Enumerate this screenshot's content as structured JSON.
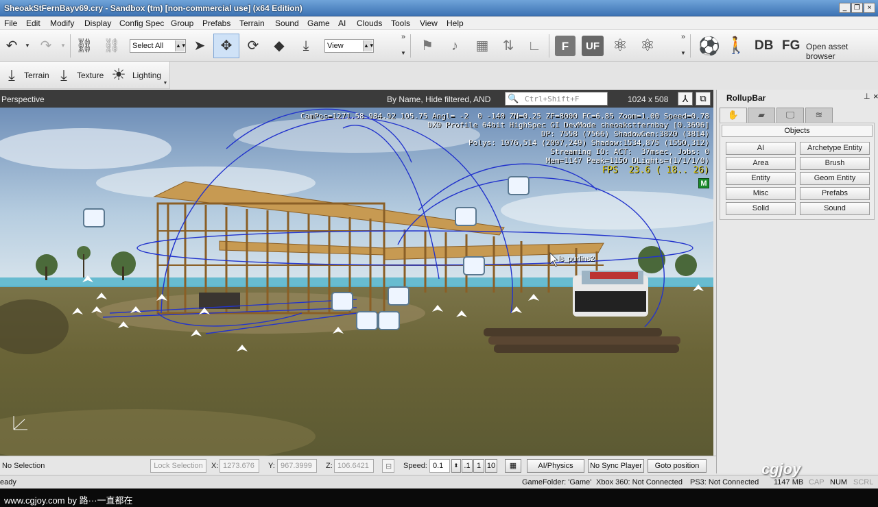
{
  "window": {
    "title": "SheoakStFernBayv69.cry - Sandbox (tm) [non-commercial use] (x64 Edition)",
    "minimize": "_",
    "restore": "❐",
    "close": "×"
  },
  "menu": [
    "File",
    "Edit",
    "Modify",
    "Display",
    "Config Spec",
    "Group",
    "Prefabs",
    "Terrain",
    "Sound",
    "Game",
    "AI",
    "Clouds",
    "Tools",
    "View",
    "Help"
  ],
  "toolbar": {
    "select_combo": "Select All",
    "view_combo": "View",
    "db_label": "DB",
    "fg_label": "FG",
    "f_label": "F",
    "uf_label": "UF",
    "asset_browser": "Open asset browser"
  },
  "toolbar2": {
    "terrain": "Terrain",
    "texture": "Texture",
    "lighting": "Lighting"
  },
  "viewport": {
    "name": "Perspective",
    "filter": "By Name, Hide filtered, AND",
    "search_placeholder": "Ctrl+Shift+F",
    "resolution": "1024 x 508",
    "hud_lines": [
      "CamPos=1271.58 984.92 105.75 Angl= -2  0 -140 ZN=0.25 ZF=8000 FC=6.85 Zoom=1.00 Speed=0.78",
      "DX9 Profile 64bit HighSpec GI DevMode sheoakstfernbay [0.3696]",
      "DP: 7558 (7566) ShadowGen:3820 (3814)",
      "Polys: 1976,514 (2097,249) Shadow:1534,875 (1550,312)",
      "Streaming IO: ACT:  37msec, Jobs: 0",
      "Mem=1147 Peak=1150 DLights=(1/1/1/0)"
    ],
    "fps": "FPS  23.6 ( 18.. 26)",
    "m_badge": "M",
    "object_label": "ls_purlins2"
  },
  "rollup": {
    "title": "RollupBar",
    "pin": "⊥",
    "close": "×",
    "section": "Objects",
    "buttons": [
      [
        "AI",
        "Archetype Entity"
      ],
      [
        "Area",
        "Brush"
      ],
      [
        "Entity",
        "Geom Entity"
      ],
      [
        "Misc",
        "Prefabs"
      ],
      [
        "Solid",
        "Sound"
      ]
    ]
  },
  "status": {
    "selection": "No Selection",
    "lock_selection": "Lock Selection",
    "x_label": "X:",
    "x_value": "1273.676",
    "y_label": "Y:",
    "y_value": "967.3999",
    "z_label": "Z:",
    "z_value": "106.6421",
    "speed_label": "Speed:",
    "speed_value": "0.1",
    "speed_options": [
      ".1",
      "1",
      "10"
    ],
    "ai_physics": "AI/Physics",
    "no_sync": "No Sync Player",
    "goto": "Goto position"
  },
  "readybar": {
    "ready": "eady",
    "game_folder": "GameFolder: 'Game'",
    "xbox": "Xbox 360: Not Connected",
    "ps3": "PS3: Not Connected",
    "mem": "1147 MB",
    "cap": "CAP",
    "num": "NUM",
    "scrl": "SCRL"
  },
  "footer": {
    "credit": "www.cgjoy.com by 路···一直都在",
    "watermark": "cgjoy"
  },
  "colors": {
    "title_blue": "#3d73b3",
    "fps_yellow": "#e6d21a",
    "m_green": "#1a8a2a",
    "sphere_blue": "#2233cc"
  }
}
